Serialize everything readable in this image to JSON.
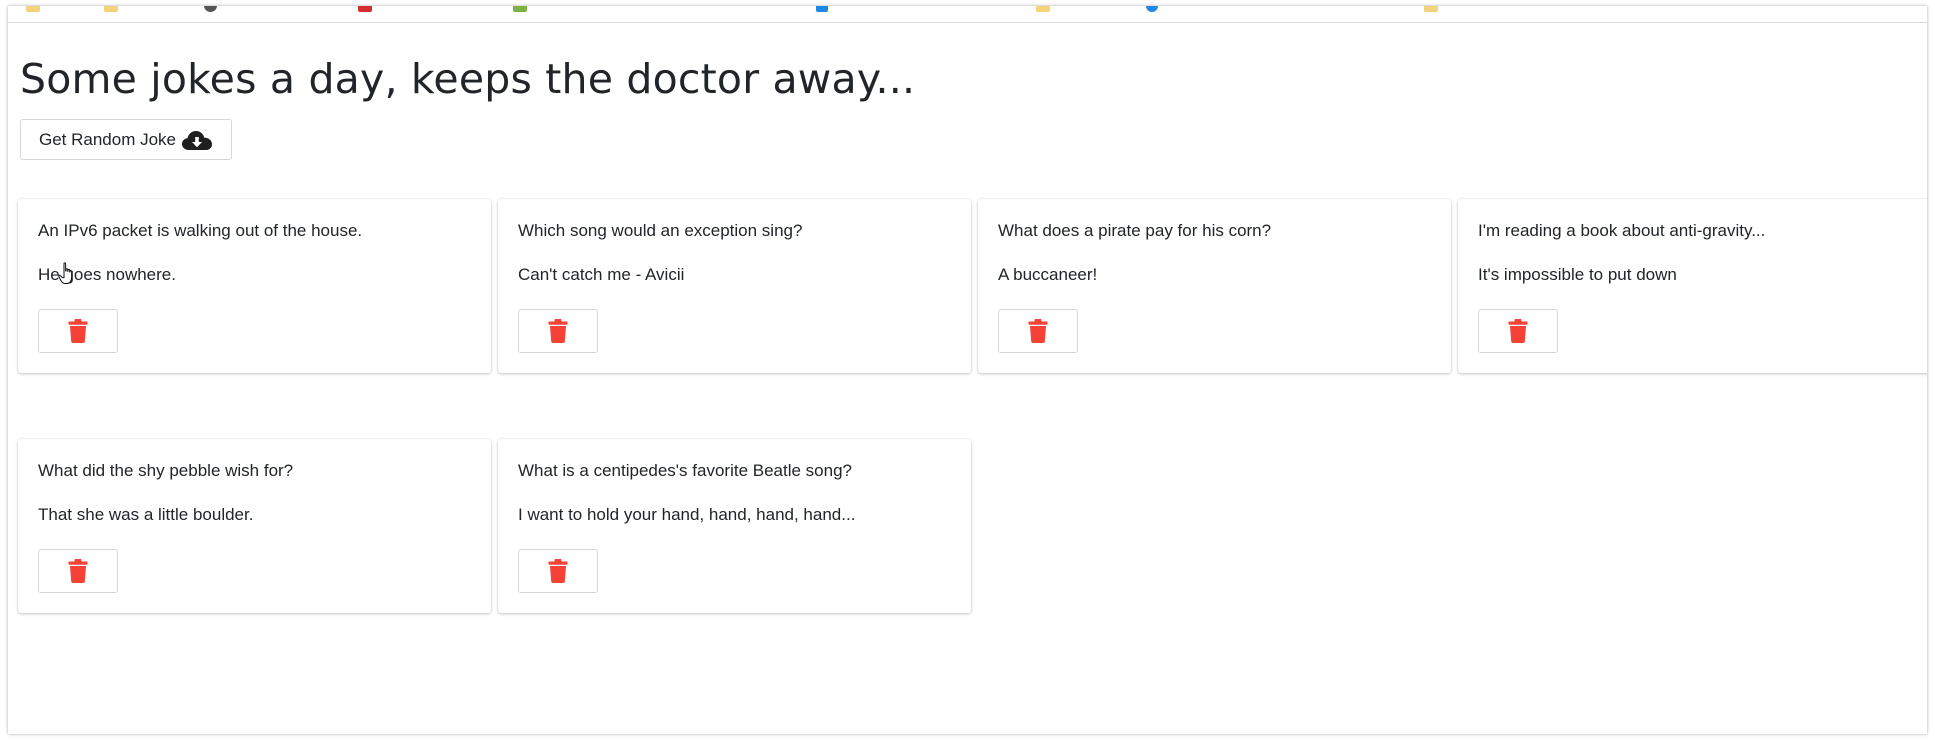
{
  "page": {
    "title": "Some jokes a day, keeps the doctor away...",
    "get_button_label": "Get Random Joke"
  },
  "jokes": [
    {
      "setup": "An IPv6 packet is walking out of the house.",
      "punchline": "He goes nowhere."
    },
    {
      "setup": "Which song would an exception sing?",
      "punchline": "Can't catch me - Avicii"
    },
    {
      "setup": "What does a pirate pay for his corn?",
      "punchline": "A buccaneer!"
    },
    {
      "setup": "I'm reading a book about anti-gravity...",
      "punchline": "It's impossible to put down"
    },
    {
      "setup": "What did the shy pebble wish for?",
      "punchline": "That she was a little boulder."
    },
    {
      "setup": "What is a centipedes's favorite Beatle song?",
      "punchline": "I want to hold your hand, hand, hand, hand..."
    }
  ],
  "icons": {
    "get_button_icon": "cloud-download-icon",
    "delete_icon": "trash-icon"
  },
  "colors": {
    "delete_icon": "#f44336",
    "text": "#212529"
  }
}
